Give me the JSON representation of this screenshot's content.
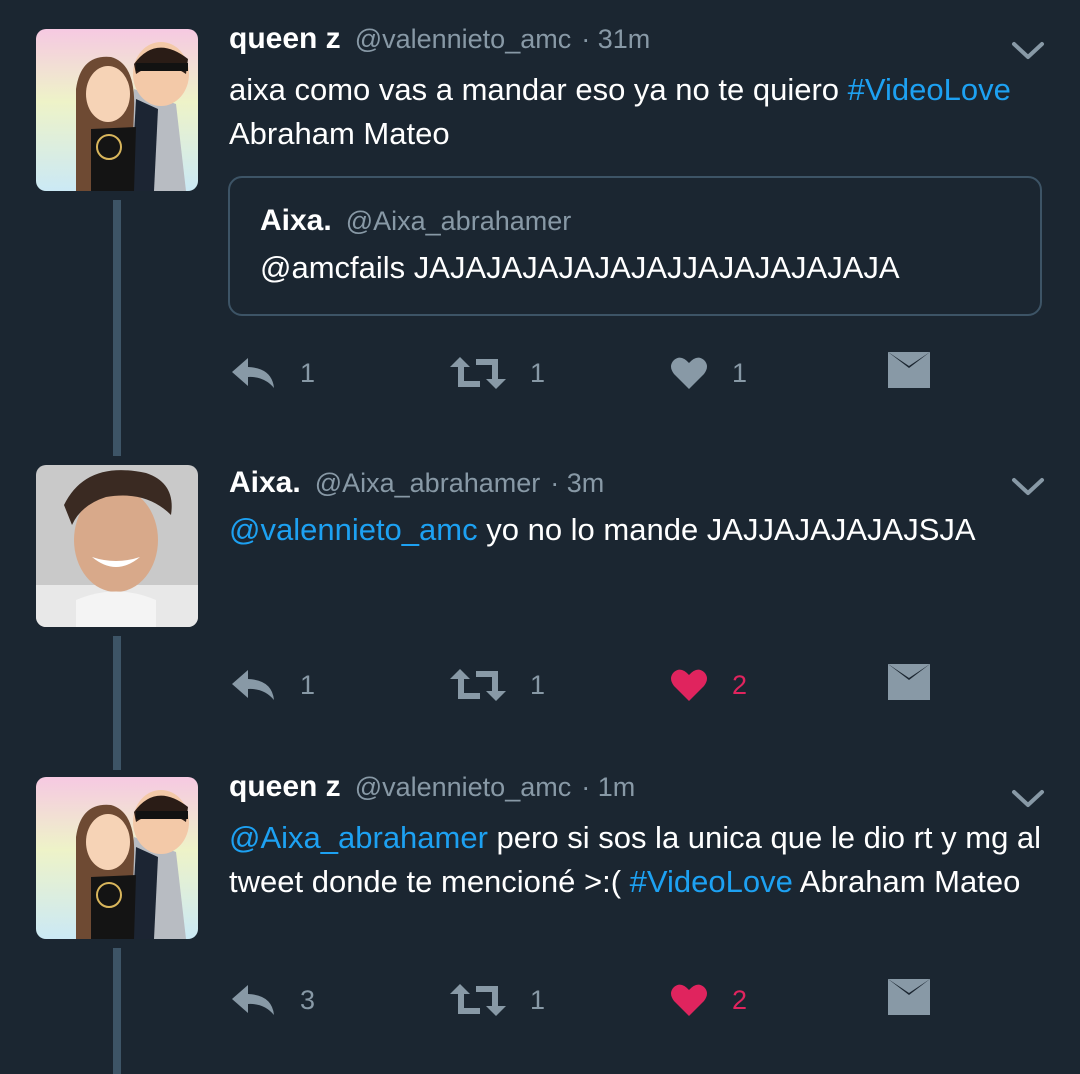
{
  "tweets": [
    {
      "name": "queen z",
      "handle": "@valennieto_amc",
      "time": "· 31m",
      "text_parts": [
        {
          "text": "aixa como vas a mandar eso ya no te quiero ",
          "link": false
        },
        {
          "text": "#VideoLove",
          "link": true
        },
        {
          "text": " Abraham Mateo",
          "link": false
        }
      ],
      "quote": {
        "name": "Aixa.",
        "handle": "@Aixa_abrahamer",
        "text": "@amcfails JAJAJAJAJAJAJAJJAJAJAJAJAJA"
      },
      "replies": "1",
      "retweets": "1",
      "likes": "1",
      "liked": false
    },
    {
      "name": "Aixa.",
      "handle": "@Aixa_abrahamer",
      "time": "· 3m",
      "text_parts": [
        {
          "text": "@valennieto_amc",
          "link": true
        },
        {
          "text": " yo no lo mande JAJJAJAJAJAJSJA",
          "link": false
        }
      ],
      "replies": "1",
      "retweets": "1",
      "likes": "2",
      "liked": true
    },
    {
      "name": "queen z",
      "handle": "@valennieto_amc",
      "time": "· 1m",
      "text_parts": [
        {
          "text": "@Aixa_abrahamer",
          "link": true
        },
        {
          "text": " pero si sos la unica que le dio rt y mg al tweet donde te mencioné >:( ",
          "link": false
        },
        {
          "text": "#VideoLove",
          "link": true
        },
        {
          "text": " Abraham Mateo",
          "link": false
        }
      ],
      "replies": "3",
      "retweets": "1",
      "likes": "2",
      "liked": true
    }
  ],
  "colors": {
    "background": "#1b2631",
    "link": "#1da1f2",
    "muted": "#8899a6",
    "like": "#e0245e"
  },
  "icons": [
    "reply-icon",
    "retweet-icon",
    "heart-icon",
    "direct-message-icon",
    "chevron-down-icon"
  ]
}
